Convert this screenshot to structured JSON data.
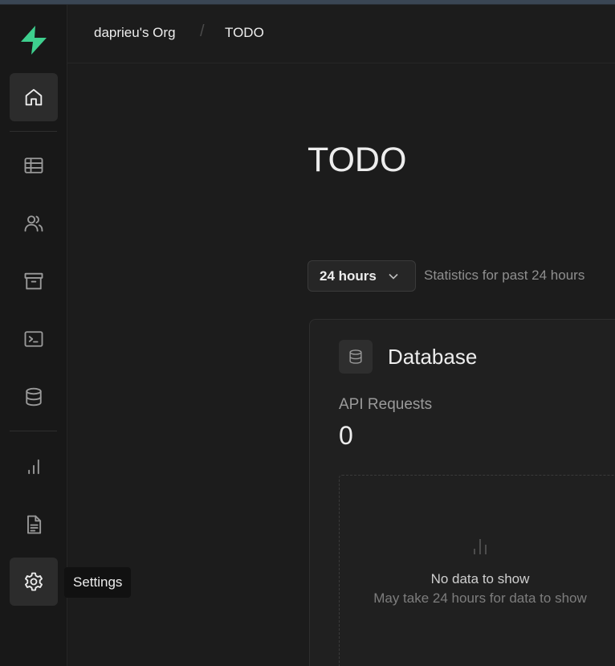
{
  "breadcrumb": {
    "org": "daprieu's Org",
    "separator": "/",
    "project": "TODO"
  },
  "tooltip": "Settings",
  "page": {
    "title": "TODO"
  },
  "period": {
    "selected": "24 hours",
    "description": "Statistics for past 24 hours"
  },
  "card": {
    "title": "Database",
    "metric_label": "API Requests",
    "metric_value": "0",
    "empty_title": "No data to show",
    "empty_subtitle": "May take 24 hours for data to show"
  },
  "colors": {
    "brand": "#3ecf8e",
    "background": "#1c1c1c",
    "sidebar": "#181818"
  },
  "icons": [
    "supabase-logo",
    "home-icon",
    "table-editor-icon",
    "users-icon",
    "storage-icon",
    "terminal-icon",
    "database-icon",
    "reports-icon",
    "logs-icon",
    "settings-icon"
  ]
}
